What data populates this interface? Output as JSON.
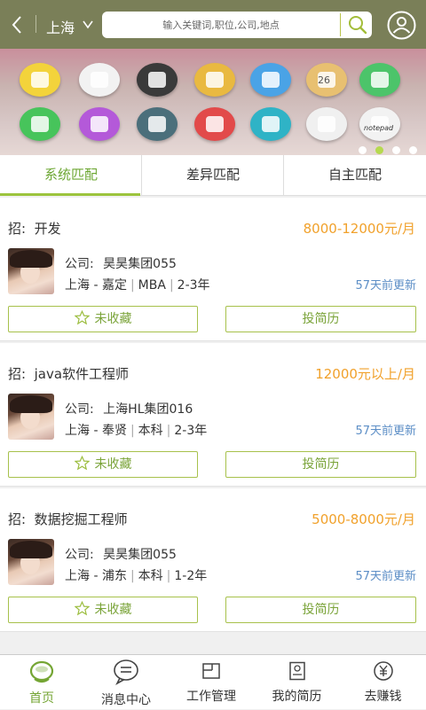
{
  "header": {
    "city": "上海",
    "search_placeholder": "输入关键词,职位,公司,地点"
  },
  "banner": {
    "apps": [
      {
        "icon": "calculator-icon",
        "color": "#f3d33b"
      },
      {
        "icon": "camera-icon",
        "color": "#f2f2f2"
      },
      {
        "icon": "clock-icon",
        "color": "#3a3a3a"
      },
      {
        "icon": "shopping-bag-icon",
        "color": "#e9b940"
      },
      {
        "icon": "weather-icon",
        "color": "#4aa3e6"
      },
      {
        "icon": "calendar-icon",
        "color": "#e8c071"
      },
      {
        "icon": "gallery-icon",
        "color": "#4cc46a"
      },
      {
        "icon": "phone-icon",
        "color": "#47c45b"
      },
      {
        "icon": "message-icon",
        "color": "#b459d9"
      },
      {
        "icon": "settings-icon",
        "color": "#4b6f7b"
      },
      {
        "icon": "support-icon",
        "color": "#e24a4a"
      },
      {
        "icon": "video-icon",
        "color": "#2fb3c6"
      },
      {
        "icon": "bookmark-icon",
        "color": "#f0f0f0"
      },
      {
        "icon": "notepad-icon",
        "color": "#f2f2f2"
      }
    ],
    "calendar_day": "26",
    "notepad_label": "notepad",
    "page_count": 4,
    "active_page": 2
  },
  "tabs": [
    {
      "label": "系统匹配",
      "active": true
    },
    {
      "label": "差异匹配",
      "active": false
    },
    {
      "label": "自主匹配",
      "active": false
    }
  ],
  "jobs": [
    {
      "title_prefix": "招:",
      "title": "开发",
      "salary": "8000-12000元/月",
      "company_label": "公司:",
      "company": "昊昊集团055",
      "location": "上海 - 嘉定",
      "education": "MBA",
      "experience": "2-3年",
      "updated": "57天前更新",
      "fav_label": "未收藏",
      "apply_label": "投简历"
    },
    {
      "title_prefix": "招:",
      "title": "java软件工程师",
      "salary": "12000元以上/月",
      "company_label": "公司:",
      "company": "上海HL集团016",
      "location": "上海 - 奉贤",
      "education": "本科",
      "experience": "2-3年",
      "updated": "57天前更新",
      "fav_label": "未收藏",
      "apply_label": "投简历"
    },
    {
      "title_prefix": "招:",
      "title": "数据挖掘工程师",
      "salary": "5000-8000元/月",
      "company_label": "公司:",
      "company": "昊昊集团055",
      "location": "上海 - 浦东",
      "education": "本科",
      "experience": "1-2年",
      "updated": "57天前更新",
      "fav_label": "未收藏",
      "apply_label": "投简历"
    }
  ],
  "nav": [
    {
      "label": "首页",
      "icon": "home-icon",
      "active": true
    },
    {
      "label": "消息中心",
      "icon": "message-center-icon",
      "active": false
    },
    {
      "label": "工作管理",
      "icon": "job-manage-icon",
      "active": false
    },
    {
      "label": "我的简历",
      "icon": "resume-icon",
      "active": false
    },
    {
      "label": "去赚钱",
      "icon": "earn-money-icon",
      "active": false
    }
  ],
  "colors": {
    "header_bg": "#7a7f58",
    "accent_green": "#9cc43d",
    "salary_orange": "#f1a12b",
    "update_blue": "#5c8ec6"
  }
}
